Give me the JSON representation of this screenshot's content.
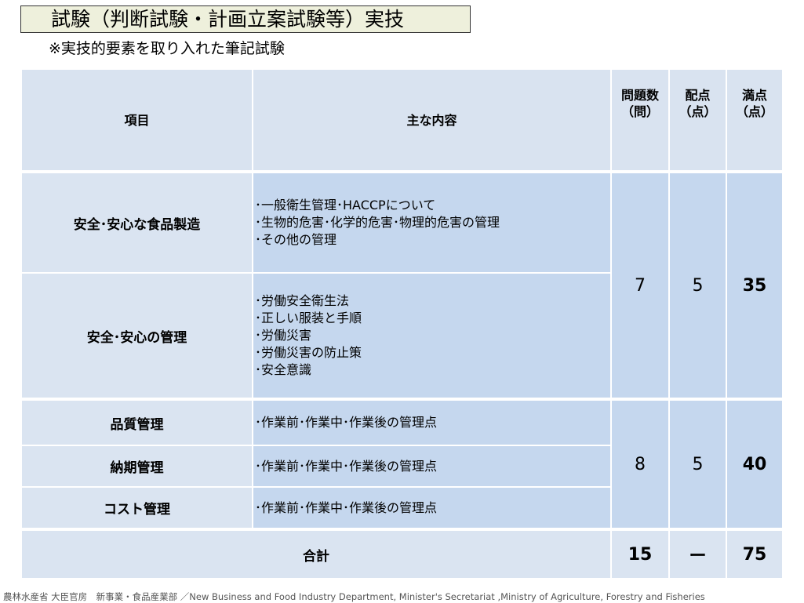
{
  "title": "試験（判断試験・計画立案試験等）実技",
  "subtitle": "※実技的要素を取り入れた筆記試験",
  "table": {
    "headers": {
      "item": "項目",
      "content": "主な内容",
      "questions_line1": "問題数",
      "questions_line2": "（問）",
      "points_line1": "配点",
      "points_line2": "（点）",
      "full_line1": "満点",
      "full_line2": "（点）"
    },
    "rows": [
      {
        "item": "安全･安心な食品製造",
        "contents": [
          "･一般衛生管理･HACCPについて",
          "･生物的危害･化学的危害･物理的危害の管理",
          "･その他の管理"
        ]
      },
      {
        "item": "安全･安心の管理",
        "contents": [
          "･労働安全衛生法",
          "･正しい服装と手順",
          "･労働災害",
          "･労働災害の防止策",
          "･安全意識"
        ]
      },
      {
        "item": "品質管理",
        "contents": [
          "･作業前･作業中･作業後の管理点"
        ]
      },
      {
        "item": "納期管理",
        "contents": [
          "･作業前･作業中･作業後の管理点"
        ]
      },
      {
        "item": "コスト管理",
        "contents": [
          "･作業前･作業中･作業後の管理点"
        ]
      }
    ],
    "groups": [
      {
        "questions": "7",
        "points": "5",
        "full": "35"
      },
      {
        "questions": "8",
        "points": "5",
        "full": "40"
      }
    ],
    "total": {
      "label": "合計",
      "questions": "15",
      "points": "ー",
      "full": "75"
    }
  },
  "footer": "農林水産省 大臣官房　新事業・食品産業部 ／New Business and Food Industry Department, Minister's Secretariat ,Ministry of Agriculture, Forestry and Fisheries"
}
